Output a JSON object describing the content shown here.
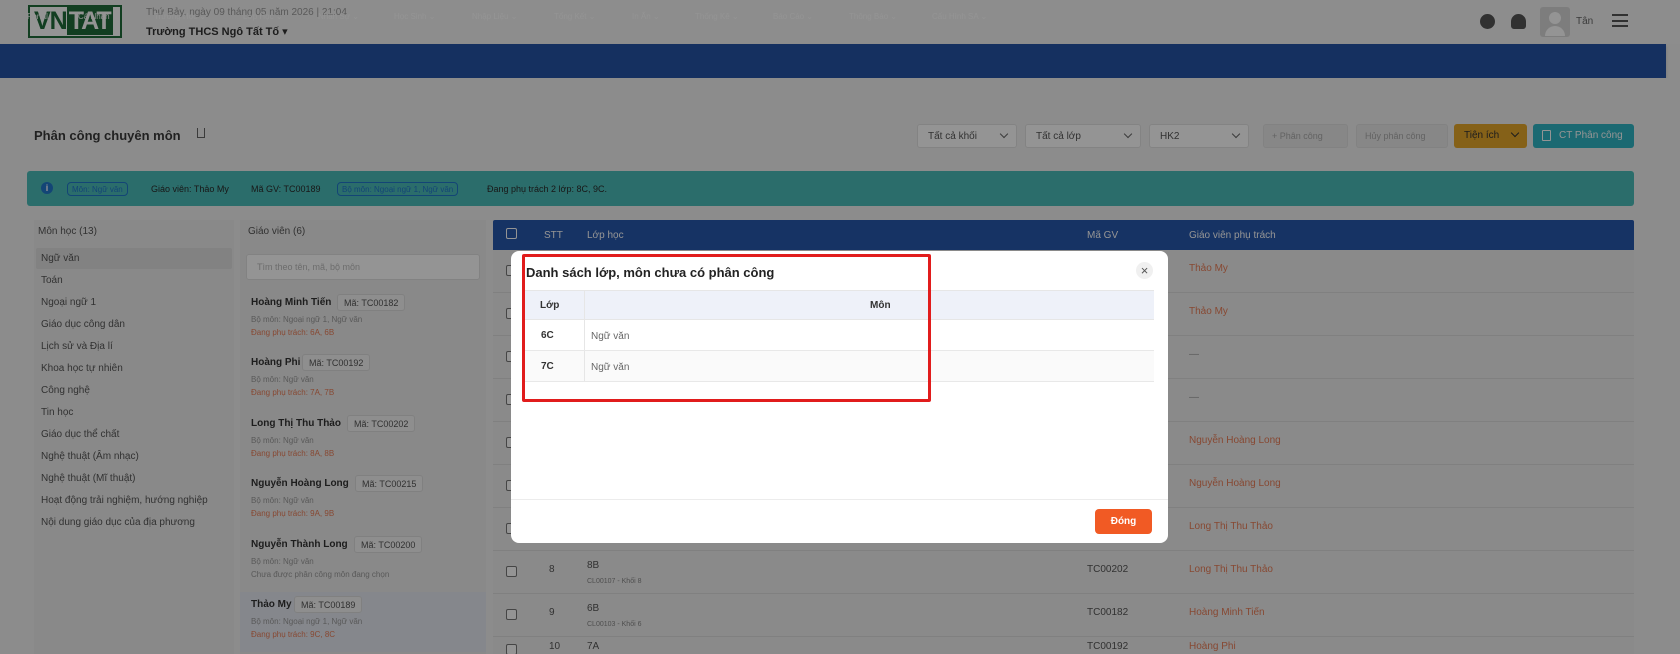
{
  "header": {
    "logo": {
      "left": "VN",
      "right": "TAT"
    },
    "datetime": "Thứ Bảy, ngày 09 tháng 05 năm 2026 | 21:04",
    "school": "Trường THCS Ngô Tất Tố",
    "user": "Tân"
  },
  "nav": [
    "Portal",
    "Cá Nhân",
    "Trường Học",
    "Lớp Học",
    "Nhân Sự",
    "Học Sinh",
    "Nhập Liệu",
    "Tổng Kết",
    "In Ấn",
    "Thống Kê",
    "Báo Cáo",
    "Thông Báo",
    "Cấu Hình SA"
  ],
  "page": {
    "title": "Phân công chuyên môn",
    "filters": {
      "khoi": "Tất cả khối",
      "lop": "Tất cả lớp",
      "hocky": "HK2"
    },
    "buttons": {
      "phancong": "Phân công",
      "huy": "Hủy phân công",
      "tienich": "Tiện ích",
      "ct": "CT Phân công"
    }
  },
  "info": {
    "mon_chip": "Môn: Ngữ văn",
    "giaovien": "Giáo viên: Thảo My",
    "magv": "Mã GV: TC00189",
    "bomon_chip": "Bộ môn: Ngoại ngữ 1, Ngữ văn",
    "phutrach": "Đang phụ trách 2 lớp: 8C, 9C."
  },
  "subjects": {
    "header": "Môn học (13)",
    "items": [
      "Ngữ văn",
      "Toán",
      "Ngoại ngữ 1",
      "Giáo dục công dân",
      "Lịch sử và Địa lí",
      "Khoa học tự nhiên",
      "Công nghệ",
      "Tin học",
      "Giáo dục thể chất",
      "Nghệ thuật (Âm nhạc)",
      "Nghệ thuật (Mĩ thuật)",
      "Hoạt động trải nghiệm, hướng nghiệp",
      "Nội dung giáo dục của địa phương"
    ]
  },
  "teachers": {
    "header": "Giáo viên (6)",
    "search_placeholder": "Tìm theo tên, mã, bộ môn",
    "items": [
      {
        "name": "Hoàng Minh Tiến",
        "code": "Mã: TC00182",
        "dept": "Bộ môn: Ngoại ngữ 1, Ngữ văn",
        "status": "Đang phụ trách: 6A, 6B"
      },
      {
        "name": "Hoàng Phi",
        "code": "Mã: TC00192",
        "dept": "Bộ môn: Ngữ văn",
        "status": "Đang phụ trách: 7A, 7B"
      },
      {
        "name": "Long Thị Thu Thảo",
        "code": "Mã: TC00202",
        "dept": "Bộ môn: Ngữ văn",
        "status": "Đang phụ trách: 8A, 8B"
      },
      {
        "name": "Nguyễn Hoàng Long",
        "code": "Mã: TC00215",
        "dept": "Bộ môn: Ngữ văn",
        "status": "Đang phụ trách: 9A, 9B"
      },
      {
        "name": "Nguyễn Thành Long",
        "code": "Mã: TC00200",
        "dept": "Bộ môn: Ngữ văn",
        "status": "Chưa được phân công môn đang chọn"
      },
      {
        "name": "Thảo My",
        "code": "Mã: TC00189",
        "dept": "Bộ môn: Ngoại ngữ 1, Ngữ văn",
        "status": "Đang phụ trách: 9C, 8C"
      }
    ]
  },
  "table": {
    "headers": {
      "stt": "STT",
      "lop": "Lớp học",
      "magv": "Mã GV",
      "gvpt": "Giáo viên phụ trách"
    },
    "rows": [
      {
        "stt": "",
        "lop": "",
        "sub": "",
        "gv": "",
        "teacher": "Thảo My"
      },
      {
        "stt": "",
        "lop": "",
        "sub": "",
        "gv": "",
        "teacher": "Thảo My"
      },
      {
        "stt": "",
        "lop": "",
        "sub": "",
        "gv": "",
        "teacher": "—"
      },
      {
        "stt": "",
        "lop": "",
        "sub": "",
        "gv": "",
        "teacher": "—"
      },
      {
        "stt": "",
        "lop": "",
        "sub": "",
        "gv": "",
        "teacher": "Nguyễn Hoàng Long"
      },
      {
        "stt": "",
        "lop": "",
        "sub": "",
        "gv": "",
        "teacher": "Nguyễn Hoàng Long"
      },
      {
        "stt": "",
        "lop": "",
        "sub": "",
        "gv": "",
        "teacher": "Long Thị Thu Thảo"
      },
      {
        "stt": "8",
        "lop": "8B",
        "sub": "CL00107 - Khối 8",
        "gv": "TC00202",
        "teacher": "Long Thị Thu Thảo"
      },
      {
        "stt": "9",
        "lop": "6B",
        "sub": "CL00103 - Khối 6",
        "gv": "TC00182",
        "teacher": "Hoàng Minh Tiến"
      },
      {
        "stt": "10",
        "lop": "7A",
        "sub": "",
        "gv": "TC00192",
        "teacher": "Hoàng Phi"
      }
    ]
  },
  "modal": {
    "title": "Danh sách lớp, môn chưa có phân công",
    "col_lop": "Lớp",
    "col_mon": "Môn",
    "rows": [
      {
        "lop": "6C",
        "mon": "Ngữ văn"
      },
      {
        "lop": "7C",
        "mon": "Ngữ văn"
      }
    ],
    "close_label": "Đóng",
    "close_icon": "×"
  }
}
